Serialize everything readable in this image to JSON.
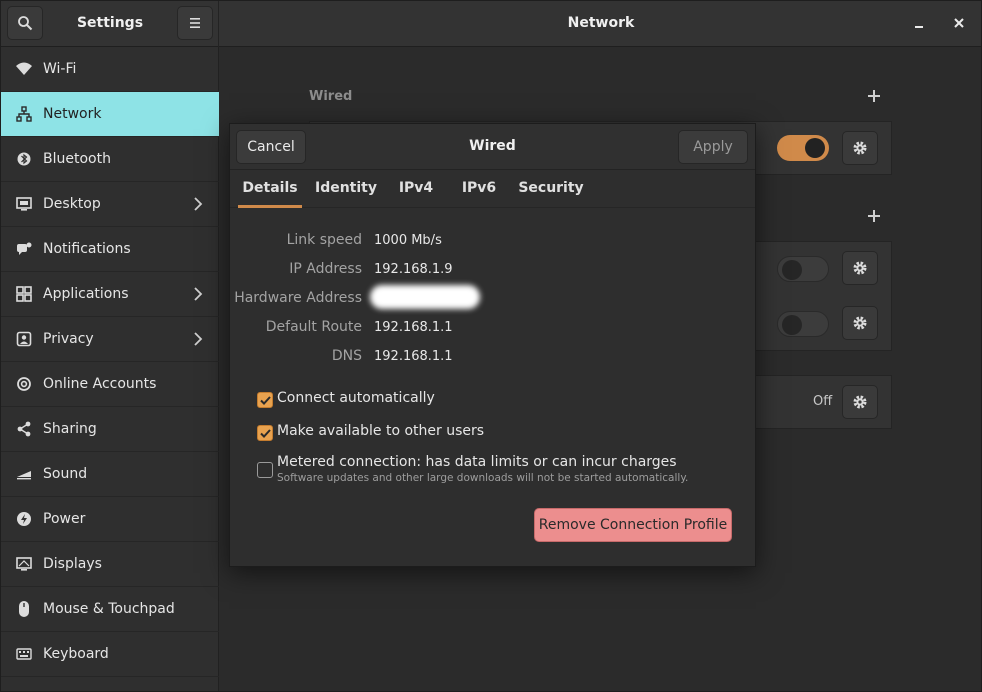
{
  "header": {
    "settings_title": "Settings",
    "main_title": "Network",
    "minimize_label": "_",
    "close_label": "✕"
  },
  "sidebar": {
    "items": [
      {
        "label": "Wi-Fi",
        "icon": "wifi-icon",
        "has_submenu": false,
        "active": false
      },
      {
        "label": "Network",
        "icon": "network-icon",
        "has_submenu": false,
        "active": true
      },
      {
        "label": "Bluetooth",
        "icon": "bluetooth-icon",
        "has_submenu": false,
        "active": false
      },
      {
        "label": "Desktop",
        "icon": "desktop-icon",
        "has_submenu": true,
        "active": false
      },
      {
        "label": "Notifications",
        "icon": "notifications-icon",
        "has_submenu": false,
        "active": false
      },
      {
        "label": "Applications",
        "icon": "applications-icon",
        "has_submenu": true,
        "active": false
      },
      {
        "label": "Privacy",
        "icon": "privacy-icon",
        "has_submenu": true,
        "active": false
      },
      {
        "label": "Online Accounts",
        "icon": "online-accounts-icon",
        "has_submenu": false,
        "active": false
      },
      {
        "label": "Sharing",
        "icon": "sharing-icon",
        "has_submenu": false,
        "active": false
      },
      {
        "label": "Sound",
        "icon": "sound-icon",
        "has_submenu": false,
        "active": false
      },
      {
        "label": "Power",
        "icon": "power-icon",
        "has_submenu": false,
        "active": false
      },
      {
        "label": "Displays",
        "icon": "displays-icon",
        "has_submenu": false,
        "active": false
      },
      {
        "label": "Mouse & Touchpad",
        "icon": "mouse-icon",
        "has_submenu": false,
        "active": false
      },
      {
        "label": "Keyboard",
        "icon": "keyboard-icon",
        "has_submenu": false,
        "active": false
      }
    ]
  },
  "main": {
    "wired_section_label": "Wired",
    "wired_toggle_on": true,
    "vpn_toggles_on": [
      false,
      false
    ],
    "proxy_status": "Off"
  },
  "dialog": {
    "title": "Wired",
    "cancel_label": "Cancel",
    "apply_label": "Apply",
    "tabs": [
      "Details",
      "Identity",
      "IPv4",
      "IPv6",
      "Security"
    ],
    "active_tab": "Details",
    "details": {
      "link_speed_label": "Link speed",
      "link_speed_value": "1000 Mb/s",
      "ip_address_label": "IP Address",
      "ip_address_value": "192.168.1.9",
      "hardware_address_label": "Hardware Address",
      "default_route_label": "Default Route",
      "default_route_value": "192.168.1.1",
      "dns_label": "DNS",
      "dns_value": "192.168.1.1"
    },
    "options": {
      "connect_automatically": {
        "label": "Connect automatically",
        "checked": true
      },
      "available_to_others": {
        "label": "Make available to other users",
        "checked": true
      },
      "metered": {
        "label": "Metered connection: has data limits or can incur charges",
        "sublabel": "Software updates and other large downloads will not be started automatically.",
        "checked": false
      }
    },
    "remove_label": "Remove Connection Profile"
  },
  "colors": {
    "accent": "#d08a4a",
    "checkbox": "#e8a24f",
    "sidebar_active": "#8ee3e6",
    "danger": "#ec8e8e"
  }
}
